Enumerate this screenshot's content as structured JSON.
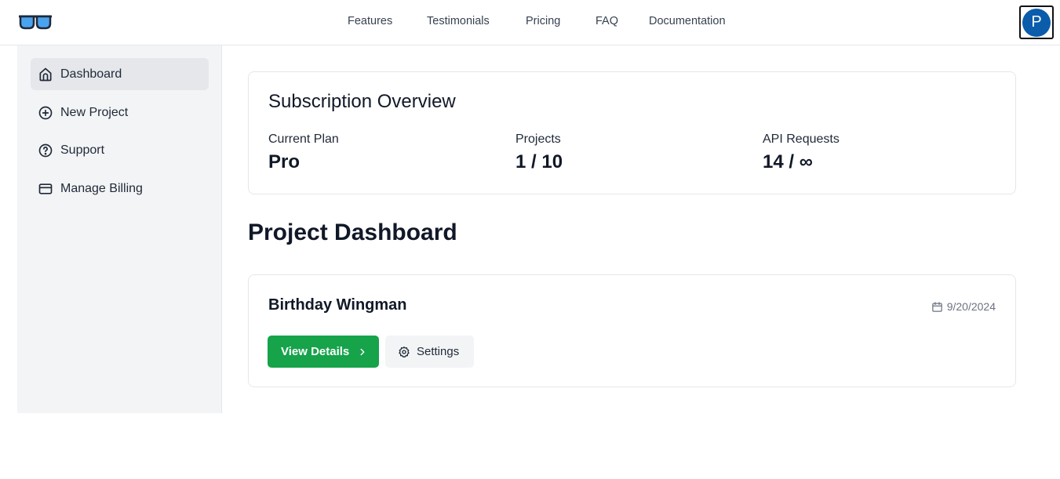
{
  "header": {
    "logo_icon": "sunglasses-icon",
    "nav": [
      {
        "label": "Features"
      },
      {
        "label": "Testimonials"
      },
      {
        "label": "Pricing"
      },
      {
        "label": "FAQ"
      },
      {
        "label": "Documentation"
      }
    ],
    "avatar_initial": "P",
    "avatar_color": "#0b5cab"
  },
  "sidebar": {
    "items": [
      {
        "label": "Dashboard",
        "icon": "home-icon",
        "active": true
      },
      {
        "label": "New Project",
        "icon": "plus-circle-icon"
      },
      {
        "label": "Support",
        "icon": "help-circle-icon"
      },
      {
        "label": "Manage Billing",
        "icon": "credit-card-icon"
      }
    ]
  },
  "subscription": {
    "title": "Subscription Overview",
    "stats": [
      {
        "label": "Current Plan",
        "value": "Pro"
      },
      {
        "label": "Projects",
        "value": "1 / 10"
      },
      {
        "label": "API Requests",
        "value": "14 / ∞"
      }
    ]
  },
  "dashboard": {
    "title": "Project Dashboard",
    "projects": [
      {
        "name": "Birthday Wingman",
        "date": "9/20/2024",
        "view_label": "View Details",
        "settings_label": "Settings"
      }
    ]
  },
  "colors": {
    "accent_green": "#16a34a",
    "sidebar_bg": "#f3f4f6"
  }
}
